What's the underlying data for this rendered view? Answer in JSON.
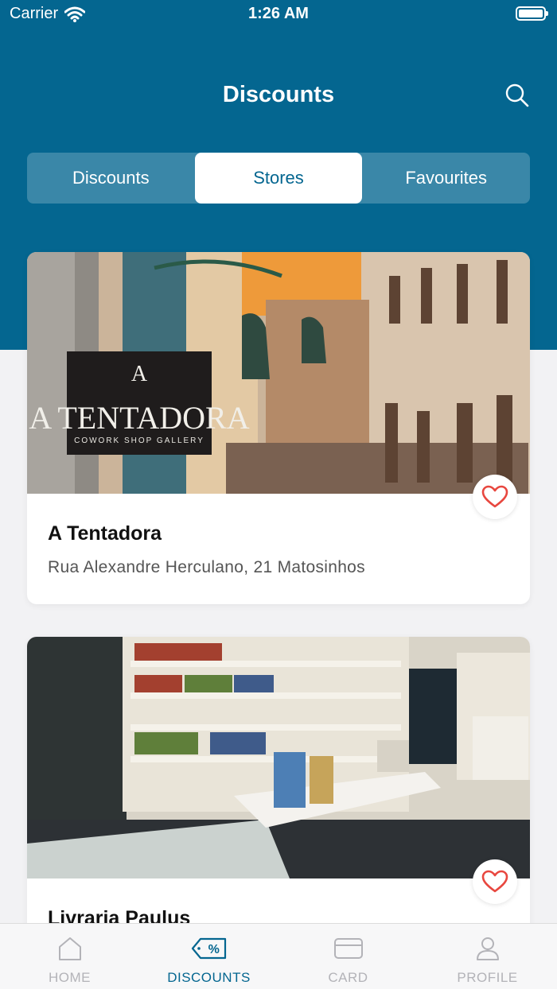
{
  "status_bar": {
    "carrier": "Carrier",
    "time": "1:26 AM"
  },
  "header": {
    "title": "Discounts"
  },
  "segments": [
    {
      "label": "Discounts",
      "active": false
    },
    {
      "label": "Stores",
      "active": true
    },
    {
      "label": "Favourites",
      "active": false
    }
  ],
  "stores": [
    {
      "name": "A Tentadora",
      "address": "Rua Alexandre Herculano, 21 Matosinhos",
      "sign_title": "A TENTADORA",
      "sign_subtitle": "COWORK SHOP GALLERY"
    },
    {
      "name": "Livraria Paulus",
      "address": ""
    }
  ],
  "tabbar": {
    "items": [
      {
        "label": "HOME",
        "icon": "home-icon"
      },
      {
        "label": "DISCOUNTS",
        "icon": "discount-tag-icon",
        "active": true
      },
      {
        "label": "CARD",
        "icon": "card-icon"
      },
      {
        "label": "PROFILE",
        "icon": "profile-icon"
      }
    ]
  },
  "colors": {
    "primary": "#046690",
    "heart": "#e8473f",
    "inactive": "#b3b3b8"
  }
}
